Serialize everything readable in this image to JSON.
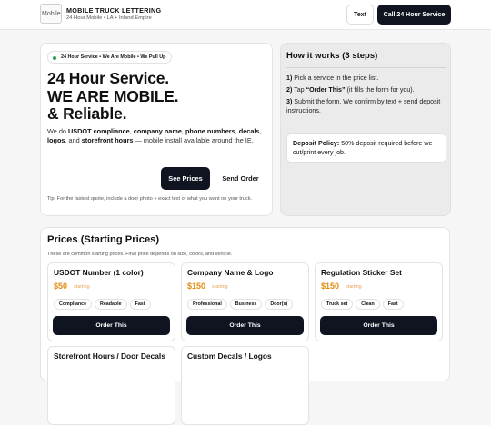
{
  "header": {
    "logo_alt": "Mobile",
    "brand": "MOBILE TRUCK LETTERING",
    "tagline": "24 Hour Mobile • LA + Inland Empire",
    "text_button": "Text",
    "call_button": "Call 24 Hour Service"
  },
  "hero": {
    "pill": "24 Hour Service • We Are Mobile • We Pull Up",
    "line1": "24 Hour Service.",
    "line2": "WE ARE MOBILE.",
    "line3": "& Reliable.",
    "desc": {
      "p1": "We do ",
      "b1": "USDOT compliance",
      "p2": ", ",
      "b2": "company name",
      "p3": ", ",
      "b3": "phone numbers",
      "p4": ", ",
      "b4": "decals",
      "p5": ", ",
      "b5": "logos",
      "p6": ", and ",
      "b6": "storefront hours",
      "p7": " — mobile install available around the IE."
    },
    "see_prices": "See Prices",
    "send_order": "Send Order",
    "tip": "Tip: For the fastest quote, include a door photo + exact text of what you want on your truck."
  },
  "how": {
    "title": "How it works (3 steps)",
    "step1_num": "1)",
    "step1_text": " Pick a service in the price list.",
    "step2_num": "2)",
    "step2_a": " Tap ",
    "step2_b": "“Order This”",
    "step2_c": " (it fills the form for you).",
    "step3_num": "3)",
    "step3_text": " Submit the form. We confirm by text + send deposit instructions.",
    "policy_label": "Deposit Policy:",
    "policy_text": " 50% deposit required before we cut/print every job."
  },
  "prices": {
    "title": "Prices (Starting Prices)",
    "subtitle": "These are common starting prices. Final price depends on size, colors, and vehicle.",
    "starting_label": "starting",
    "order_label": "Order This",
    "cards": [
      {
        "name": "USDOT Number (1 color)",
        "price": "$50",
        "tags": [
          "Compliance",
          "Readable",
          "Fast"
        ]
      },
      {
        "name": "Company Name & Logo",
        "price": "$150",
        "tags": [
          "Professional",
          "Business",
          "Door(s)"
        ]
      },
      {
        "name": "Regulation Sticker Set",
        "price": "$150",
        "tags": [
          "Truck set",
          "Clean",
          "Fast"
        ]
      },
      {
        "name": "Storefront Hours / Door Decals",
        "price": "",
        "tags": []
      },
      {
        "name": "Custom Decals / Logos",
        "price": "",
        "tags": []
      }
    ]
  },
  "colors": {
    "dark_button": "#0f1420",
    "price_orange": "#e5890f",
    "status_green": "#2e9b4a",
    "panel_gray": "#ebebeb"
  }
}
